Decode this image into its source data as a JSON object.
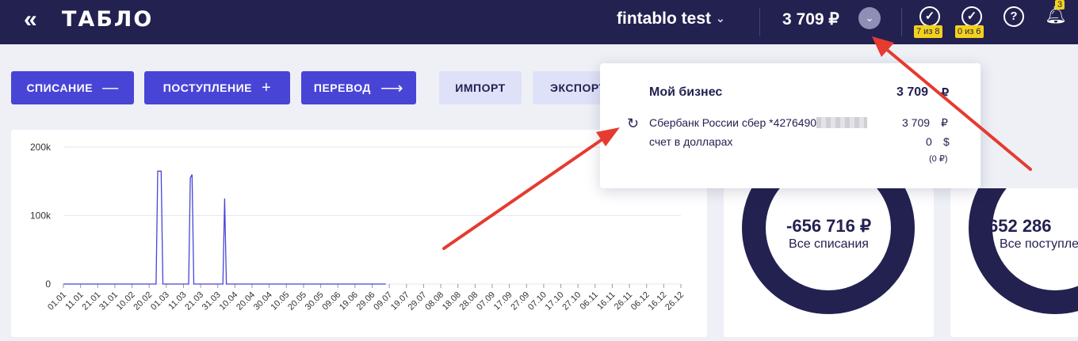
{
  "header": {
    "back_glyph": "«",
    "logo": "ТАБЛО",
    "company": "fintablo test",
    "balance": "3 709 ₽",
    "tasks_badge": "7 из 8",
    "checks_badge": "0 из 6",
    "notifications_count": "3"
  },
  "actions": {
    "write_off": "СПИСАНИЕ",
    "income": "ПОСТУПЛЕНИЕ",
    "transfer": "ПЕРЕВОД",
    "import": "ИМПОРТ",
    "export": "ЭКСПОРТ"
  },
  "accounts_popup": {
    "group_name": "Мой бизнес",
    "group_total": "3 709",
    "group_currency": "₽",
    "accounts": [
      {
        "name": "Сбербанк России сбер *4276490",
        "amount": "3 709",
        "currency": "₽",
        "converted": ""
      },
      {
        "name": "счет в долларах",
        "amount": "0",
        "currency": "$",
        "converted": "(0 ₽)"
      }
    ]
  },
  "summary": {
    "expenses_value": "-656 716 ₽",
    "expenses_label": "Все списания",
    "income_value": "652 286",
    "income_label": "Все поступления"
  },
  "chart_data": {
    "type": "line",
    "y_ticks": [
      "200k",
      "100k",
      "0"
    ],
    "ylim": [
      0,
      200000
    ],
    "categories": [
      "01.01",
      "11.01",
      "21.01",
      "31.01",
      "10.02",
      "20.02",
      "01.03",
      "11.03",
      "21.03",
      "31.03",
      "10.04",
      "20.04",
      "30.04",
      "10.05",
      "20.05",
      "30.05",
      "09.06",
      "19.06",
      "29.06",
      "09.07",
      "19.07",
      "29.07",
      "08.08",
      "18.08",
      "28.08",
      "07.09",
      "17.09",
      "27.09",
      "07.10",
      "17.10",
      "27.10",
      "06.11",
      "16.11",
      "26.11",
      "06.12",
      "16.12",
      "26.12"
    ],
    "series": [
      {
        "color": "#4845d6",
        "points": [
          [
            0,
            0
          ],
          [
            5.4,
            0
          ],
          [
            5.5,
            165000
          ],
          [
            5.7,
            165000
          ],
          [
            5.8,
            0
          ],
          [
            7.3,
            0
          ],
          [
            7.4,
            155000
          ],
          [
            7.5,
            160000
          ],
          [
            7.6,
            0
          ],
          [
            9.3,
            0
          ],
          [
            9.4,
            125000
          ],
          [
            9.5,
            0
          ],
          [
            18.8,
            0
          ]
        ]
      }
    ]
  }
}
